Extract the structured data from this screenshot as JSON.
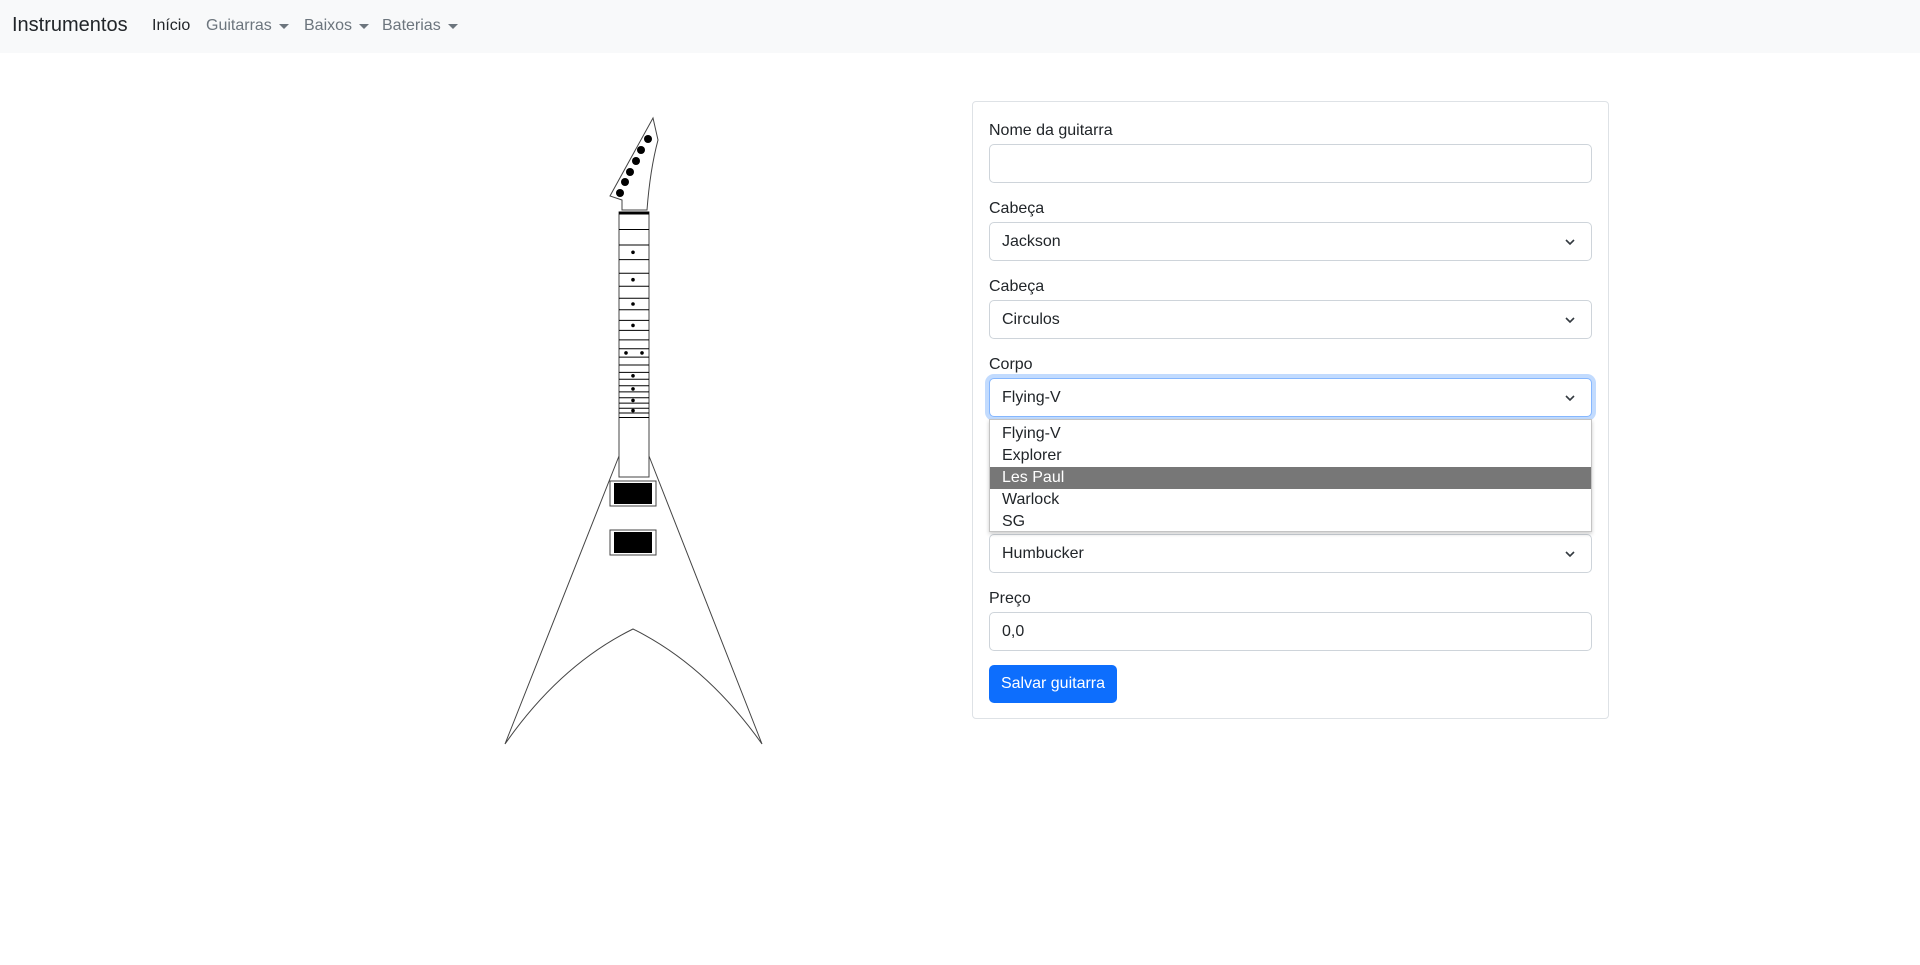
{
  "navbar": {
    "brand": "Instrumentos",
    "links": [
      {
        "label": "Início"
      },
      {
        "label": "Guitarras"
      },
      {
        "label": "Baixos"
      },
      {
        "label": "Baterias"
      }
    ]
  },
  "form": {
    "name": {
      "label": "Nome da guitarra",
      "value": ""
    },
    "head": {
      "label": "Cabeça",
      "value": "Jackson"
    },
    "inlay": {
      "label": "Cabeça",
      "value": "Circulos"
    },
    "body": {
      "label": "Corpo",
      "value": "Flying-V",
      "options": [
        "Flying-V",
        "Explorer",
        "Les Paul",
        "Warlock",
        "SG"
      ],
      "highlighted": "Les Paul"
    },
    "pickups": {
      "value": "Humbucker"
    },
    "price": {
      "label": "Preço",
      "value": "0,0"
    },
    "submit": "Salvar guitarra"
  },
  "colors": {
    "primary": "#0d6efd",
    "navbar_bg": "#f8f9fa",
    "highlight": "#777777"
  }
}
